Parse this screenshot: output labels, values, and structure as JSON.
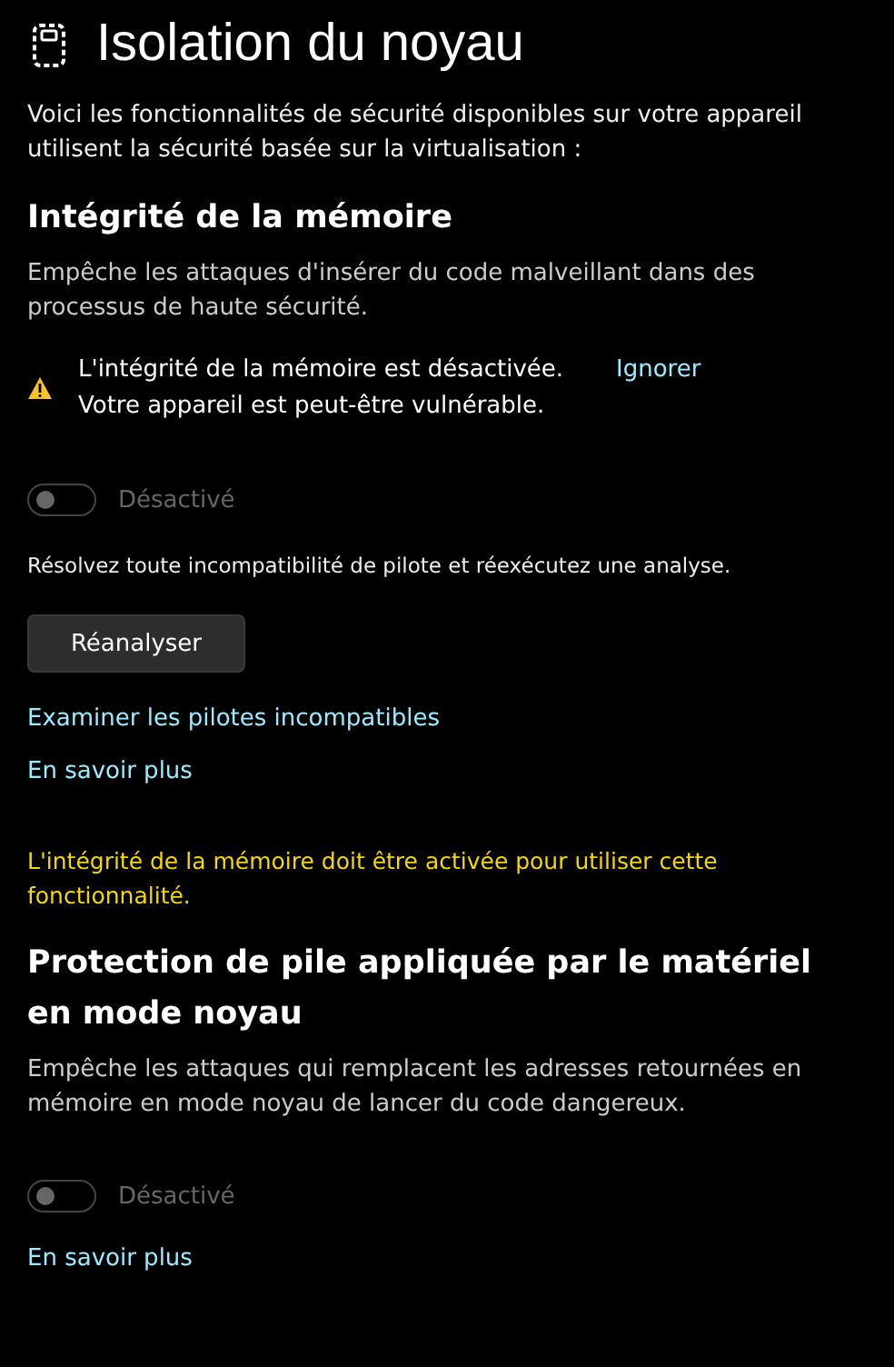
{
  "title": "Isolation du noyau",
  "intro": "Voici les fonctionnalités de sécurité disponibles sur votre appareil utilisent la sécurité basée sur la virtualisation :",
  "sections": [
    {
      "heading": "Intégrité de la mémoire",
      "description": "Empêche les attaques d'insérer du code malveillant dans des processus de haute sécurité.",
      "warning": {
        "text": "L'intégrité de la mémoire est désactivée. Votre appareil est peut-être vulnérable.",
        "action": "Ignorer"
      },
      "toggle": {
        "label": "Désactivé",
        "on": false,
        "disabled": true
      },
      "hint": "Résolvez toute incompatibilité de pilote et réexécutez une analyse.",
      "button": "Réanalyser",
      "links": [
        "Examiner les pilotes incompatibles",
        "En savoir plus"
      ],
      "note": "L'intégrité de la mémoire doit être activée pour utiliser cette fonctionnalité."
    },
    {
      "heading": "Protection de pile appliquée par le matériel en mode noyau",
      "description": "Empêche les attaques qui remplacent les adresses retournées en mémoire en mode noyau de lancer du code dangereux.",
      "toggle": {
        "label": "Désactivé",
        "on": false,
        "disabled": true
      },
      "links": [
        "En savoir plus"
      ]
    }
  ]
}
